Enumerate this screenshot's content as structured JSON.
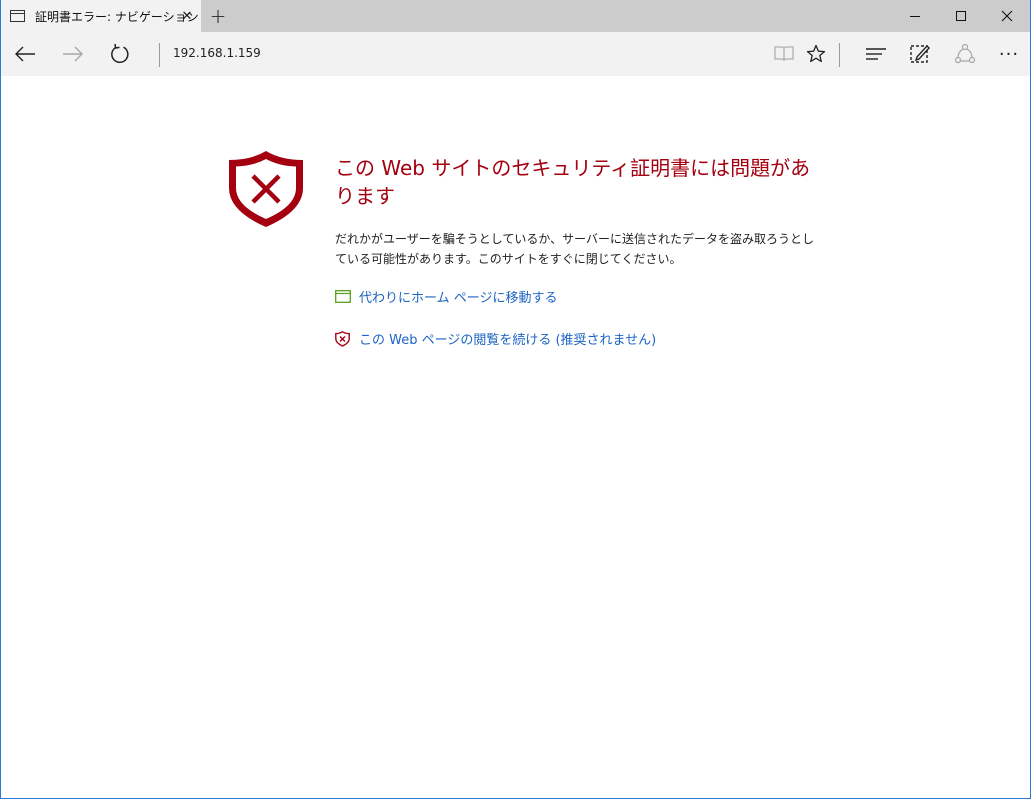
{
  "tab": {
    "title": "証明書エラー: ナビゲーション",
    "close_glyph": "✕",
    "new_tab_glyph": "+"
  },
  "window_controls": {
    "minimize": "minimize-icon",
    "maximize": "maximize-icon",
    "close": "close-icon"
  },
  "navbar": {
    "address": "192.168.1.159",
    "more_glyph": "···"
  },
  "error": {
    "title": "この Web サイトのセキュリティ証明書には問題があります",
    "description": "だれかがユーザーを騙そうとしているか、サーバーに送信されたデータを盗み取ろうとしている可能性があります。このサイトをすぐに閉じてください。",
    "link_home": "代わりにホーム ページに移動する",
    "link_continue": "この Web ページの閲覧を続ける (推奨されません)"
  },
  "colors": {
    "accent_red": "#a4000f",
    "link_blue": "#1c64c4",
    "window_border": "#2b7ad8"
  }
}
